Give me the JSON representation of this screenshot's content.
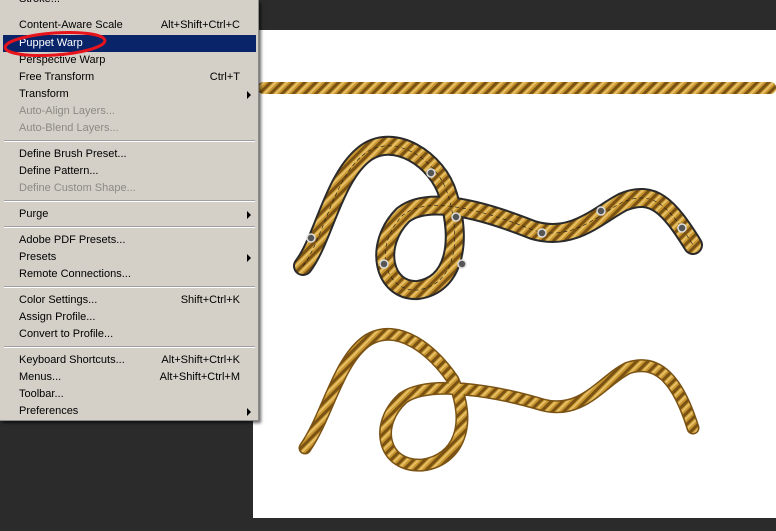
{
  "menu": {
    "items_top": [
      {
        "label": "Stroke...",
        "shortcut": ""
      },
      {
        "label": "Content-Aware Scale",
        "shortcut": "Alt+Shift+Ctrl+C"
      },
      {
        "label": "Puppet Warp",
        "shortcut": ""
      },
      {
        "label": "Perspective Warp",
        "shortcut": ""
      },
      {
        "label": "Free Transform",
        "shortcut": "Ctrl+T"
      },
      {
        "label": "Transform",
        "shortcut": ""
      },
      {
        "label": "Auto-Align Layers...",
        "shortcut": ""
      },
      {
        "label": "Auto-Blend Layers...",
        "shortcut": ""
      }
    ],
    "group2": [
      {
        "label": "Define Brush Preset..."
      },
      {
        "label": "Define Pattern..."
      },
      {
        "label": "Define Custom Shape..."
      }
    ],
    "purge": {
      "label": "Purge"
    },
    "group4": [
      {
        "label": "Adobe PDF Presets..."
      },
      {
        "label": "Presets"
      },
      {
        "label": "Remote Connections..."
      }
    ],
    "group5": [
      {
        "label": "Color Settings...",
        "shortcut": "Shift+Ctrl+K"
      },
      {
        "label": "Assign Profile...",
        "shortcut": ""
      },
      {
        "label": "Convert to Profile...",
        "shortcut": ""
      }
    ],
    "group6": [
      {
        "label": "Keyboard Shortcuts...",
        "shortcut": "Alt+Shift+Ctrl+K"
      },
      {
        "label": "Menus...",
        "shortcut": "Alt+Shift+Ctrl+M"
      },
      {
        "label": "Toolbar...",
        "shortcut": ""
      },
      {
        "label": "Preferences",
        "shortcut": ""
      }
    ],
    "selected_item": "Puppet Warp",
    "highlight_color": "#0a246a",
    "annotation_color": "#e8141c"
  },
  "canvas": {
    "background": "#ffffff",
    "rope_color": "#c8952e",
    "rope_dark": "#7a5214",
    "pin_color": "#555555"
  }
}
